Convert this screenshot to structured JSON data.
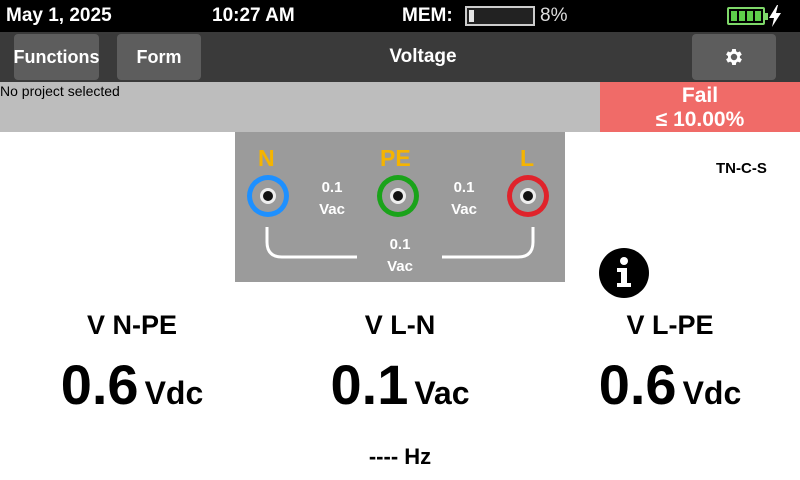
{
  "status_bar": {
    "date": "May 1, 2025",
    "time": "10:27 AM",
    "mem_label": "MEM:",
    "mem_percent": "8%",
    "mem_fill_fraction": 0.08,
    "battery_level_fraction": 1.0,
    "battery_icon": "battery-charging-icon",
    "charging_icon": "lightning-bolt-icon",
    "battery_color": "#5ecf4a"
  },
  "toolbar": {
    "functions_label": "Functions",
    "form_label": "Form",
    "title": "Voltage",
    "settings_icon": "gear-icon"
  },
  "project": {
    "text": "No project selected"
  },
  "result": {
    "status": "Fail",
    "limit": "≤ 10.00%",
    "color": "#f06b68"
  },
  "connection": {
    "terminals": [
      {
        "label": "N",
        "color": "#1e90ff"
      },
      {
        "label": "PE",
        "color": "#1aa31a"
      },
      {
        "label": "L",
        "color": "#e0232b"
      }
    ],
    "label_color": "#f5b400",
    "readings": {
      "n_pe": {
        "value": "0.1",
        "unit": "Vac"
      },
      "pe_l": {
        "value": "0.1",
        "unit": "Vac"
      },
      "n_l": {
        "value": "0.1",
        "unit": "Vac"
      }
    }
  },
  "network_type": "TN-C-S",
  "info_icon": "info-icon",
  "measurements": [
    {
      "label": "V N-PE",
      "value": "0.6",
      "unit": "Vdc"
    },
    {
      "label": "V L-N",
      "value": "0.1",
      "unit": "Vac"
    },
    {
      "label": "V L-PE",
      "value": "0.6",
      "unit": "Vdc"
    }
  ],
  "frequency": "---- Hz"
}
